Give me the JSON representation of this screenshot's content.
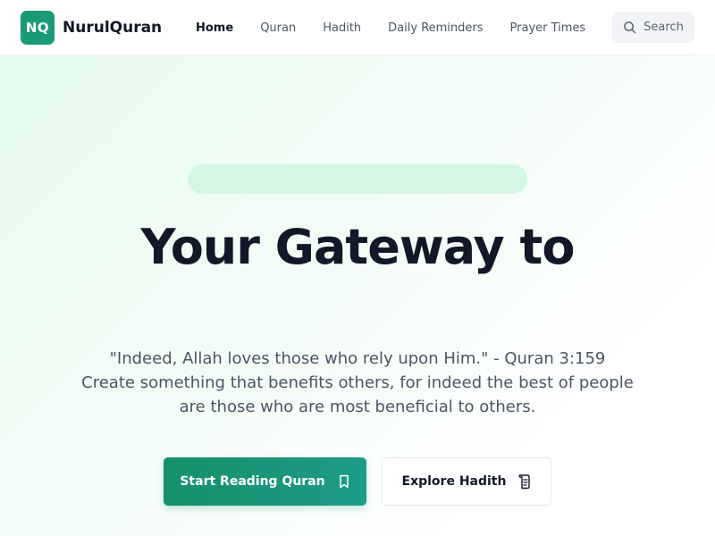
{
  "brand": {
    "badge": "NQ",
    "name": "NurulQuran",
    "color": "#1a9b78"
  },
  "nav": {
    "links": [
      "Home",
      "Quran",
      "Hadith",
      "Daily Reminders",
      "Prayer Times"
    ],
    "active": "Home",
    "search_label": "Search"
  },
  "hero": {
    "headline": "Your Gateway to",
    "quote": "\"Indeed, Allah loves those who rely upon Him.\" - Quran 3:159",
    "subtext": "Create something that benefits others, for indeed the best of people are those who are most beneficial to others.",
    "primary_button": "Start Reading Quran",
    "secondary_button": "Explore Hadith",
    "primary_icon": "book-icon",
    "secondary_icon": "scroll-icon"
  }
}
